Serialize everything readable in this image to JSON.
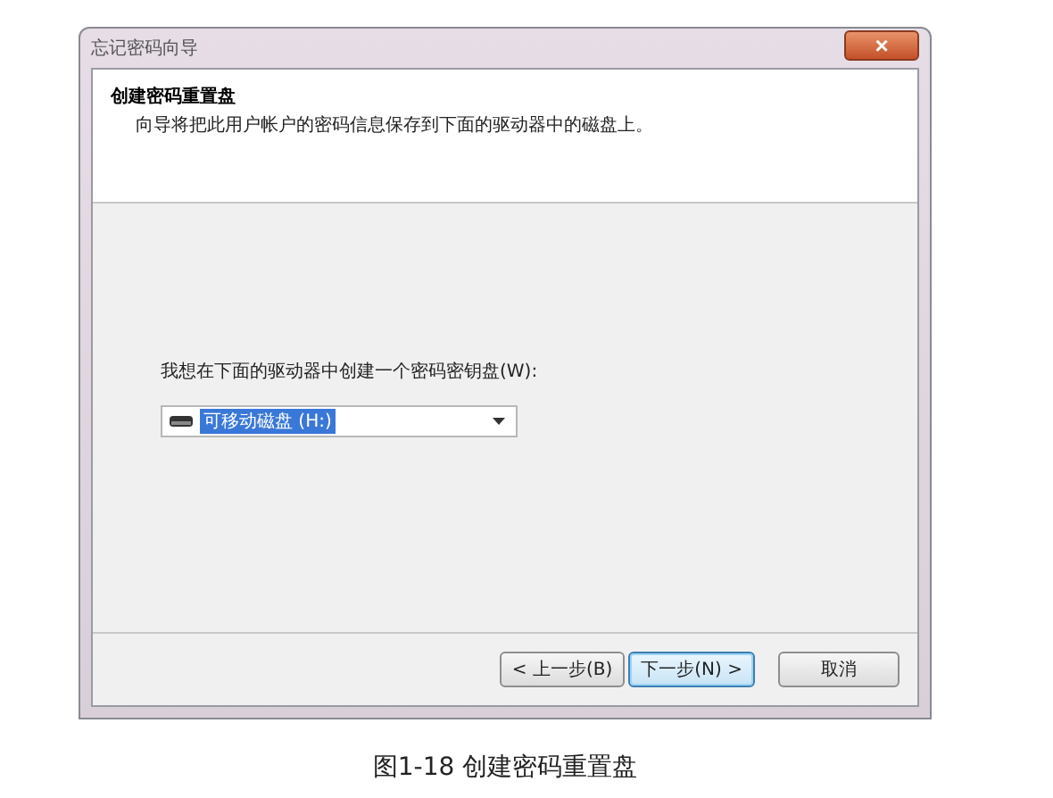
{
  "window": {
    "title": "忘记密码向导",
    "close": "×"
  },
  "header": {
    "title": "创建密码重置盘",
    "description": "向导将把此用户帐户的密码信息保存到下面的驱动器中的磁盘上。"
  },
  "prompt": "我想在下面的驱动器中创建一个密码密钥盘(W):",
  "drive_select": {
    "value": "可移动磁盘 (H:)",
    "selected": true
  },
  "buttons": [
    {
      "label": "< 上一步(B)",
      "focused": false
    },
    {
      "label": "下一步(N) >",
      "focused": true
    },
    {
      "label": "取消",
      "focused": false
    }
  ],
  "caption": "图1-18 创建密码重置盘"
}
